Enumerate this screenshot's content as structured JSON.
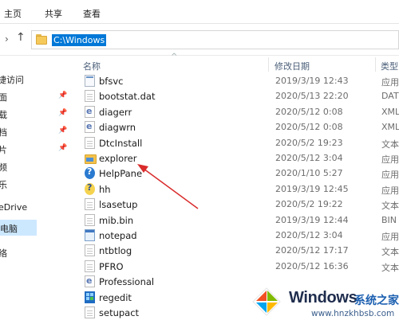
{
  "ribbon": {
    "tabs": [
      "主页",
      "共享",
      "查看"
    ]
  },
  "address": {
    "path": "C:\\Windows"
  },
  "nav": {
    "items": [
      {
        "label": "捷访问",
        "pinned": false,
        "selected": false
      },
      {
        "label": "面",
        "pinned": true,
        "selected": false
      },
      {
        "label": "载",
        "pinned": true,
        "selected": false
      },
      {
        "label": "档",
        "pinned": true,
        "selected": false
      },
      {
        "label": "片",
        "pinned": true,
        "selected": false
      },
      {
        "label": "频",
        "pinned": false,
        "selected": false
      },
      {
        "label": "乐",
        "pinned": false,
        "selected": false
      },
      {
        "label": "eDrive",
        "pinned": false,
        "selected": false
      },
      {
        "label": "电脑",
        "pinned": false,
        "selected": true
      },
      {
        "label": "络",
        "pinned": false,
        "selected": false
      }
    ]
  },
  "columns": {
    "name": "名称",
    "modified": "修改日期",
    "type": "类型"
  },
  "files": [
    {
      "name": "bfsvc",
      "date": "2019/3/19 12:43",
      "type": "应用",
      "icon": "exe"
    },
    {
      "name": "bootstat.dat",
      "date": "2020/5/13 22:20",
      "type": "DAT",
      "icon": "doc"
    },
    {
      "name": "diagerr",
      "date": "2020/5/12 0:08",
      "type": "XML",
      "icon": "xml"
    },
    {
      "name": "diagwrn",
      "date": "2020/5/12 0:08",
      "type": "XML",
      "icon": "xml"
    },
    {
      "name": "DtcInstall",
      "date": "2020/5/2 19:23",
      "type": "文本",
      "icon": "doc"
    },
    {
      "name": "explorer",
      "date": "2020/5/12 3:04",
      "type": "应用",
      "icon": "explorer"
    },
    {
      "name": "HelpPane",
      "date": "2020/1/10 5:27",
      "type": "应用",
      "icon": "help"
    },
    {
      "name": "hh",
      "date": "2019/3/19 12:45",
      "type": "应用",
      "icon": "hh"
    },
    {
      "name": "lsasetup",
      "date": "2020/5/2 19:22",
      "type": "文本",
      "icon": "doc"
    },
    {
      "name": "mib.bin",
      "date": "2019/3/19 12:44",
      "type": "BIN",
      "icon": "doc"
    },
    {
      "name": "notepad",
      "date": "2020/5/12 3:04",
      "type": "应用",
      "icon": "note"
    },
    {
      "name": "ntbtlog",
      "date": "2020/5/12 17:17",
      "type": "文本",
      "icon": "doc"
    },
    {
      "name": "PFRO",
      "date": "2020/5/12 16:36",
      "type": "文本",
      "icon": "doc"
    },
    {
      "name": "Professional",
      "date": "",
      "type": "",
      "icon": "xml"
    },
    {
      "name": "regedit",
      "date": "",
      "type": "",
      "icon": "reg"
    },
    {
      "name": "setupact",
      "date": "",
      "type": "",
      "icon": "doc"
    }
  ],
  "watermark": {
    "brand": "Windows",
    "tagline": "系统之家",
    "url": "www.hnzkhbsb.com"
  },
  "colors": {
    "accent": "#0078d7",
    "selection": "#cce8ff",
    "arrow": "#d92b2b"
  }
}
